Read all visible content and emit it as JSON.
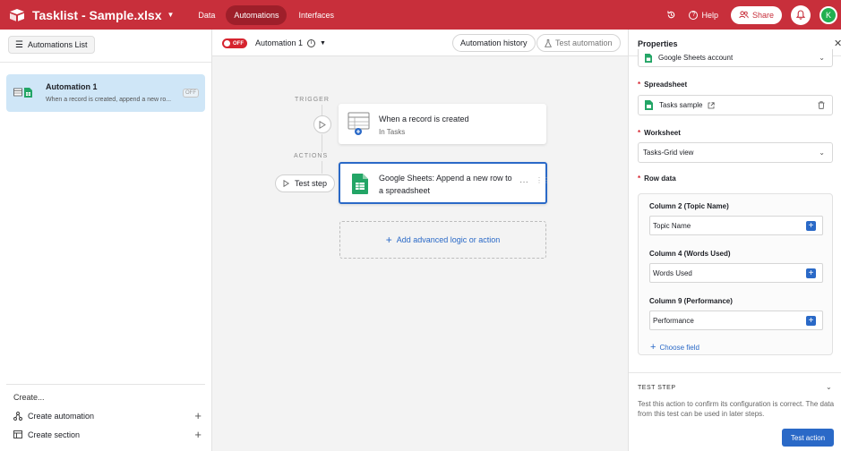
{
  "topbar": {
    "base_name": "Tasklist - Sample.xlsx",
    "tabs": [
      {
        "label": "Data",
        "active": false
      },
      {
        "label": "Automations",
        "active": true
      },
      {
        "label": "Interfaces",
        "active": false
      }
    ],
    "help_label": "Help",
    "share_label": "Share",
    "avatar_initial": "K",
    "bar_color": "#c82f3b"
  },
  "sidebar": {
    "list_button_label": "Automations List",
    "automation": {
      "name": "Automation 1",
      "description": "When a record is created, append a new ro...",
      "status_badge": "OFF"
    },
    "create_label": "Create...",
    "create_automation_label": "Create automation",
    "create_section_label": "Create section"
  },
  "canvas": {
    "toggle_label": "OFF",
    "automation_title": "Automation 1",
    "history_button": "Automation history",
    "test_button": "Test automation",
    "trigger_label": "TRIGGER",
    "actions_label": "ACTIONS",
    "trigger_card": {
      "title": "When a record is created",
      "subtitle": "In Tasks"
    },
    "action_card": {
      "title": "Google Sheets: Append a new row to a spreadsheet"
    },
    "test_step_button": "Test step",
    "add_logic_label": "Add advanced logic or action"
  },
  "properties": {
    "title": "Properties",
    "account_value": "Google Sheets account",
    "spreadsheet_label": "Spreadsheet",
    "spreadsheet_value": "Tasks sample",
    "worksheet_label": "Worksheet",
    "worksheet_value": "Tasks-Grid view",
    "row_data_label": "Row data",
    "columns": [
      {
        "label": "Column 2 (Topic Name)",
        "value": "Topic Name"
      },
      {
        "label": "Column 4 (Words Used)",
        "value": "Words Used"
      },
      {
        "label": "Column 9 (Performance)",
        "value": "Performance"
      }
    ],
    "choose_field_label": "Choose field",
    "test_step_title": "TEST STEP",
    "test_step_description": "Test this action to confirm its configuration is correct. The data from this test can be used in later steps.",
    "test_action_button": "Test action",
    "accent_color": "#2a69c7"
  }
}
